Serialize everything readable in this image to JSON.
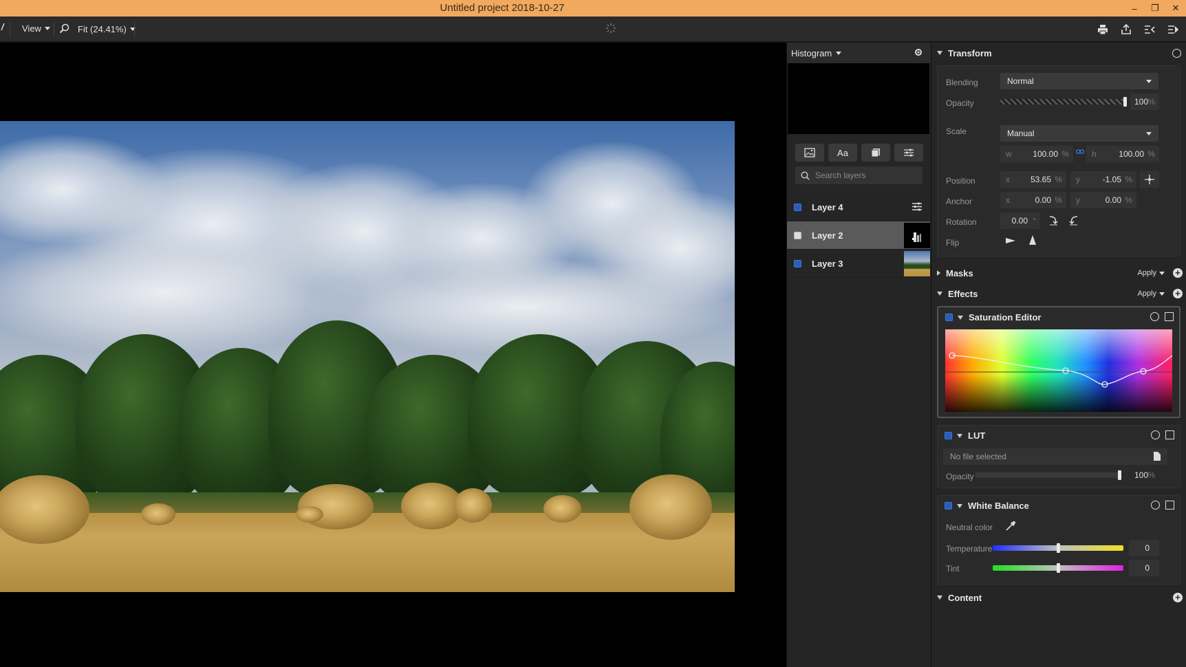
{
  "window": {
    "title": "Untitled project 2018-10-27",
    "minimize": "–",
    "maximize": "❐",
    "close": "✕"
  },
  "toolbar": {
    "view_label": "View",
    "zoom_label": "Fit (24.41%)"
  },
  "histogram": {
    "label": "Histogram"
  },
  "layers": {
    "tools": [
      "image",
      "Aa",
      "layers",
      "adjust"
    ],
    "search_placeholder": "Search layers",
    "items": [
      {
        "name": "Layer 4",
        "selected": false
      },
      {
        "name": "Layer 2",
        "selected": true
      },
      {
        "name": "Layer 3",
        "selected": false
      }
    ]
  },
  "transform": {
    "title": "Transform",
    "blending_label": "Blending",
    "blending_value": "Normal",
    "opacity_label": "Opacity",
    "opacity_value": "100",
    "scale_label": "Scale",
    "scale_value": "Manual",
    "w_prefix": "w",
    "w_value": "100.00",
    "h_prefix": "h",
    "h_value": "100.00",
    "position_label": "Position",
    "pos_x": "53.65",
    "pos_y": "-1.05",
    "anchor_label": "Anchor",
    "anchor_x": "0.00",
    "anchor_y": "0.00",
    "rotation_label": "Rotation",
    "rotation_value": "0.00",
    "flip_label": "Flip",
    "x_prefix": "x",
    "y_prefix": "y",
    "pct": "%",
    "deg": "°"
  },
  "masks": {
    "title": "Masks",
    "apply": "Apply"
  },
  "effects": {
    "title": "Effects",
    "apply": "Apply",
    "saturation_editor": "Saturation Editor",
    "lut": {
      "title": "LUT",
      "file": "No file selected",
      "opacity_label": "Opacity",
      "opacity_value": "100",
      "opacity_level": 1.0
    },
    "white_balance": {
      "title": "White Balance",
      "neutral_label": "Neutral color",
      "temperature_label": "Temperature",
      "temperature_value": "0",
      "tint_label": "Tint",
      "tint_value": "0"
    }
  },
  "content": {
    "title": "Content"
  },
  "colors": {
    "titlebar": "#f0a95e",
    "accent": "#3b78e0",
    "panel": "#252525"
  }
}
